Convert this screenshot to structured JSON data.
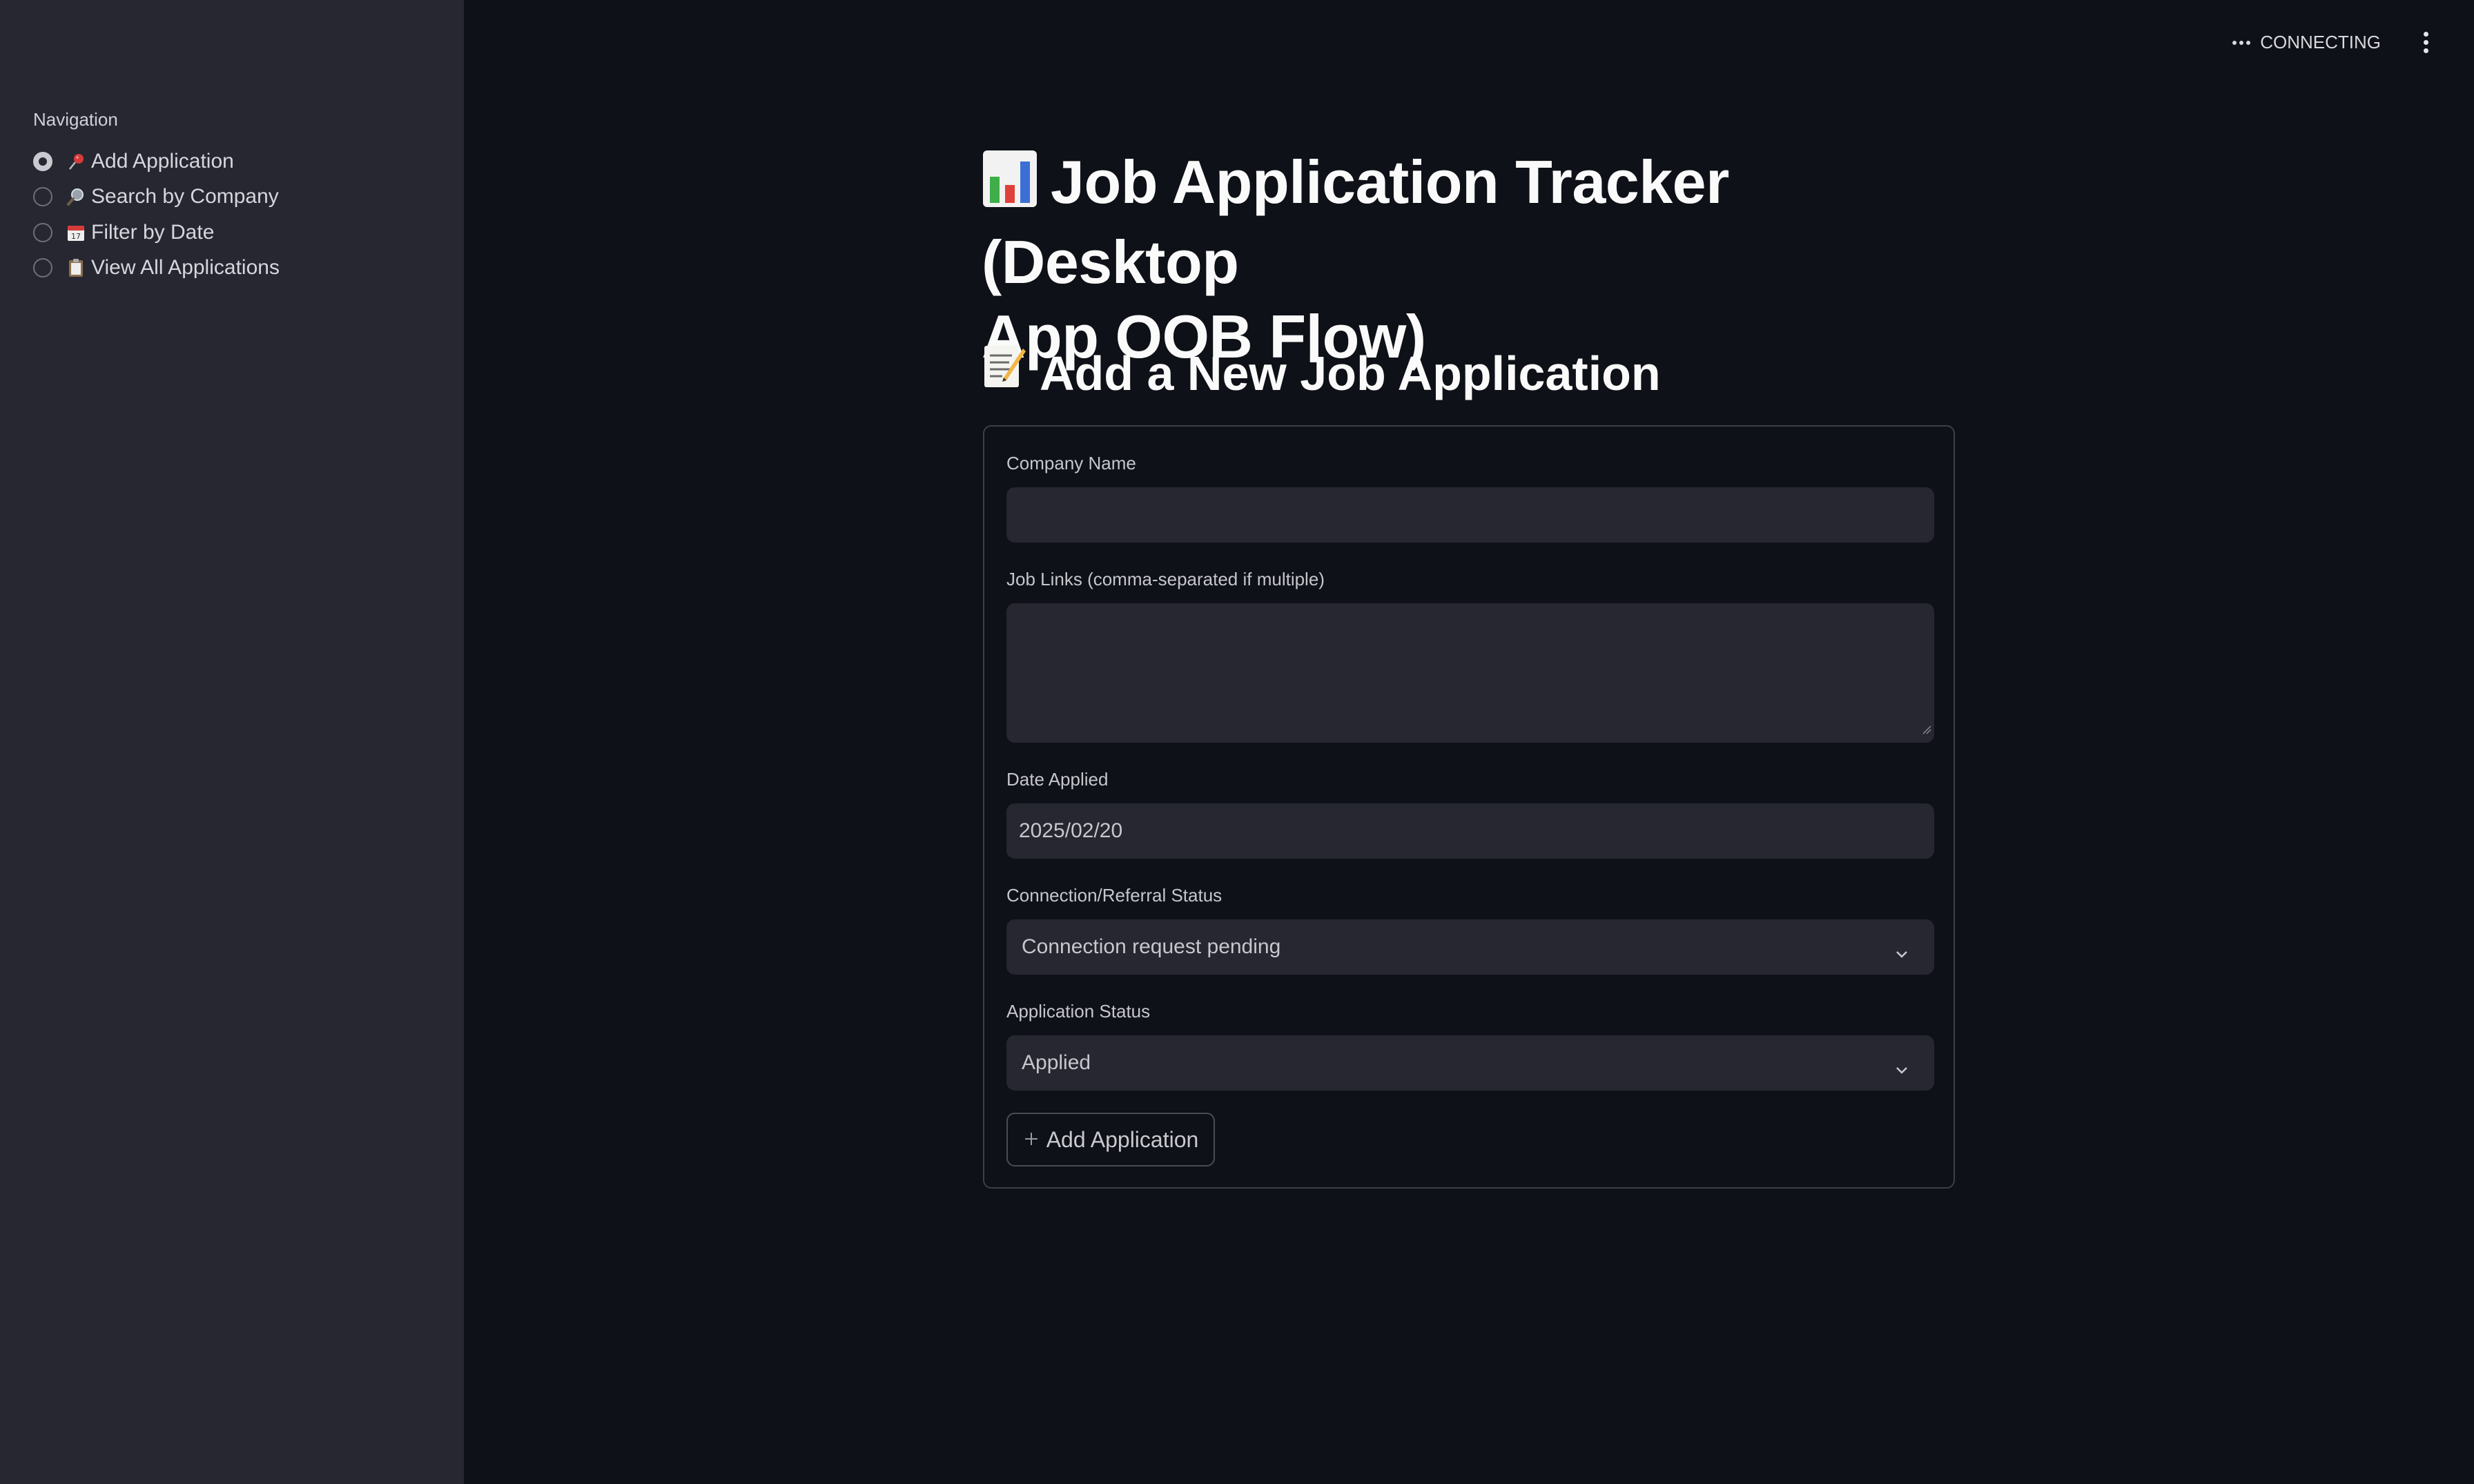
{
  "header": {
    "status_text": "CONNECTING"
  },
  "sidebar": {
    "title": "Navigation",
    "items": [
      {
        "label": "Add Application",
        "icon": "pushpin-icon",
        "selected": true
      },
      {
        "label": "Search by Company",
        "icon": "magnifier-icon",
        "selected": false
      },
      {
        "label": "Filter by Date",
        "icon": "calendar-icon",
        "selected": false
      },
      {
        "label": "View All Applications",
        "icon": "clipboard-icon",
        "selected": false
      }
    ]
  },
  "main": {
    "title_line1": "Job Application Tracker (Desktop",
    "title_line2": "App OOB Flow)",
    "title_icon": "bar-chart-icon",
    "section_title": "Add a New Job Application",
    "section_icon": "memo-icon"
  },
  "form": {
    "company_label": "Company Name",
    "company_value": "",
    "links_label": "Job Links (comma-separated if multiple)",
    "links_value": "",
    "date_label": "Date Applied",
    "date_value": "2025/02/20",
    "connection_label": "Connection/Referral Status",
    "connection_value": "Connection request pending",
    "status_label": "Application Status",
    "status_value": "Applied",
    "submit_label": "Add Application"
  },
  "colors": {
    "background": "#0e1117",
    "sidebar": "#262730",
    "input_bg": "#262730",
    "text": "#fafafa"
  }
}
